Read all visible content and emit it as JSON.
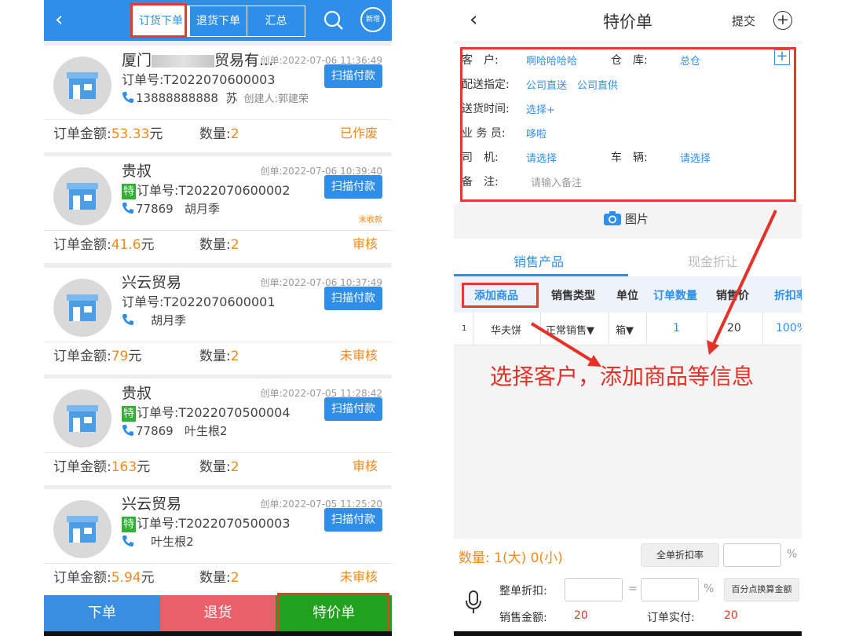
{
  "left": {
    "tabs": [
      "订货下单",
      "退货下单",
      "汇总"
    ],
    "stamp_label": "新增",
    "amount_label": "订单金额:",
    "qty_label": "数量:",
    "created_prefix": "创单:",
    "orderno_prefix": "订单号:",
    "creator_prefix": "创建人:",
    "pay_button": "扫描付款",
    "special_badge": "特",
    "orders": [
      {
        "customer": "厦门",
        "customer_suffix": "贸易有...",
        "created": "2022-07-06 11:36:49",
        "order_no": "T2022070600003",
        "special": false,
        "phone": "13888888888",
        "contact": "苏",
        "creator": "郭建荣",
        "amount": "53.33",
        "unit": "元",
        "qty": "2",
        "status": "已作废",
        "extra": ""
      },
      {
        "customer": "贵叔",
        "customer_suffix": "",
        "created": "2022-07-06 10:39:40",
        "order_no": "T2022070600002",
        "special": true,
        "phone": "77869",
        "contact": "胡月季",
        "creator": "",
        "amount": "41.6",
        "unit": "元",
        "qty": "2",
        "status": "审核",
        "extra": "未收款"
      },
      {
        "customer": "兴云贸易",
        "customer_suffix": "",
        "created": "2022-07-06 10:37:49",
        "order_no": "T2022070600001",
        "special": false,
        "phone": "",
        "contact": "胡月季",
        "creator": "",
        "amount": "79",
        "unit": "元",
        "qty": "2",
        "status": "未审核",
        "extra": ""
      },
      {
        "customer": "贵叔",
        "customer_suffix": "",
        "created": "2022-07-05 11:28:42",
        "order_no": "T2022070500004",
        "special": true,
        "phone": "77869",
        "contact": "叶生根2",
        "creator": "",
        "amount": "163",
        "unit": "元",
        "qty": "2",
        "status": "审核",
        "extra": ""
      },
      {
        "customer": "兴云贸易",
        "customer_suffix": "",
        "created": "2022-07-05 11:25:20",
        "order_no": "T2022070500003",
        "special": true,
        "phone": "",
        "contact": "叶生根2",
        "creator": "",
        "amount": "5.94",
        "unit": "元",
        "qty": "2",
        "status": "未审核",
        "extra": ""
      }
    ],
    "bottom": {
      "order": "下单",
      "return": "退货",
      "special": "特价单"
    }
  },
  "right": {
    "title": "特价单",
    "submit": "提交",
    "form": {
      "customer_label": "客　户:",
      "customer_value": "啊哈哈哈哈",
      "warehouse_label": "仓　库:",
      "warehouse_value": "总仓",
      "delivery_label": "配送指定:",
      "delivery_value1": "公司直送",
      "delivery_value2": "公司直供",
      "time_label": "送货时间:",
      "time_value": "选择+",
      "sales_label": "业 务 员:",
      "sales_value": "哆啦",
      "driver_label": "司　机:",
      "driver_value": "请选择",
      "vehicle_label": "车　辆:",
      "vehicle_value": "请选择",
      "note_label": "备　注:",
      "note_placeholder": "请输入备注"
    },
    "picture_label": "图片",
    "tabs": {
      "active": "销售产品",
      "idle": "现金折让"
    },
    "table": {
      "headers": [
        "添加商品",
        "销售类型",
        "单位",
        "订单数量",
        "销售价",
        "折扣率"
      ],
      "rows": [
        {
          "index": "1",
          "name": "华夫饼",
          "type": "正常销售▼",
          "unit": "箱▼",
          "qty": "1",
          "price": "20",
          "discount": "100%"
        }
      ]
    },
    "annotation": "选择客户，添加商品等信息",
    "footer": {
      "qty_text": "数量:  1(大)  0(小)",
      "whole_discount_btn": "全单折扣率",
      "percent": "%",
      "order_discount_label": "整单折扣:",
      "equals": "=",
      "convert_btn": "百分点换算金额",
      "sales_amount_label": "销售金额:",
      "sales_amount": "20",
      "actual_label": "订单实付:",
      "actual": "20"
    }
  }
}
